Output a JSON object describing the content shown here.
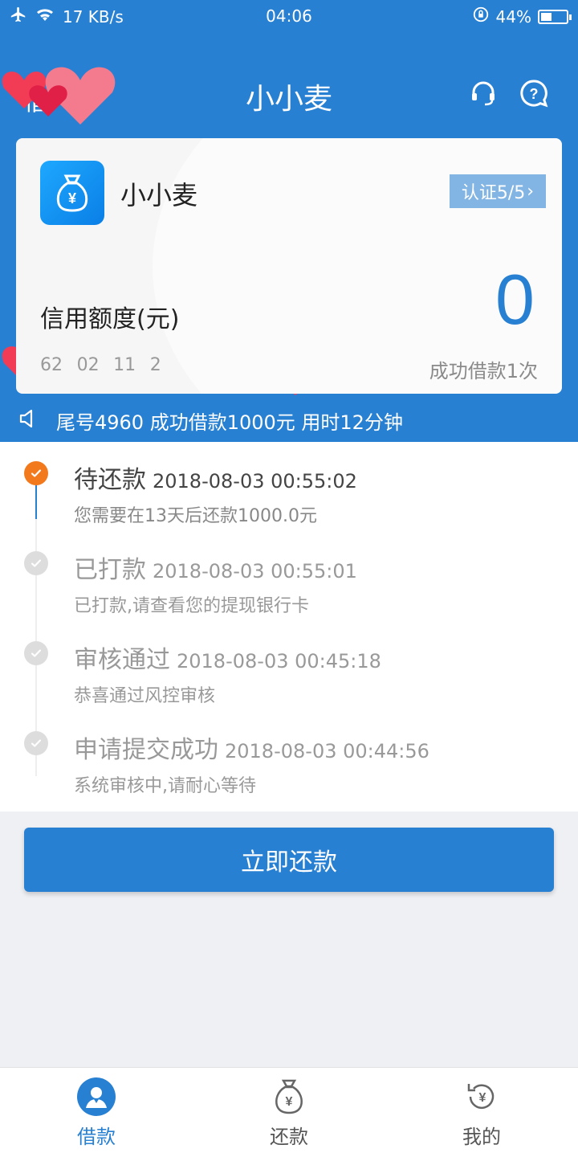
{
  "status_bar": {
    "network_speed": "17 KB/s",
    "time": "04:06",
    "battery_percent": "44%",
    "battery_level": 0.44
  },
  "header": {
    "back_text": "借",
    "title": "小小麦",
    "support_icon": "headset-icon",
    "help_icon": "question-icon"
  },
  "card": {
    "app_name": "小小麦",
    "certification": "认证5/5",
    "credit_label": "信用额度(元)",
    "credit_value": "0",
    "card_number_masked": "62    02    11    2",
    "loan_count": "成功借款1次"
  },
  "notice": {
    "icon": "speaker-icon",
    "text": "尾号4960 成功借款1000元 用时12分钟"
  },
  "timeline": [
    {
      "title": "待还款",
      "time": "2018-08-03 00:55:02",
      "desc": "您需要在13天后还款1000.0元",
      "status": "active"
    },
    {
      "title": "已打款",
      "time": "2018-08-03 00:55:01",
      "desc": "已打款,请查看您的提现银行卡",
      "status": "done"
    },
    {
      "title": "审核通过",
      "time": "2018-08-03 00:45:18",
      "desc": "恭喜通过风控审核",
      "status": "done"
    },
    {
      "title": "申请提交成功",
      "time": "2018-08-03 00:44:56",
      "desc": "系统审核中,请耐心等待",
      "status": "done"
    }
  ],
  "repay_button": "立即还款",
  "bottom_nav": [
    {
      "label": "借款",
      "icon": "user-icon",
      "active": true
    },
    {
      "label": "还款",
      "icon": "money-bag-icon",
      "active": false
    },
    {
      "label": "我的",
      "icon": "refresh-yen-icon",
      "active": false
    }
  ],
  "colors": {
    "primary": "#2880d2",
    "accent_orange": "#f27a1d",
    "done_gray": "#dddddd"
  }
}
